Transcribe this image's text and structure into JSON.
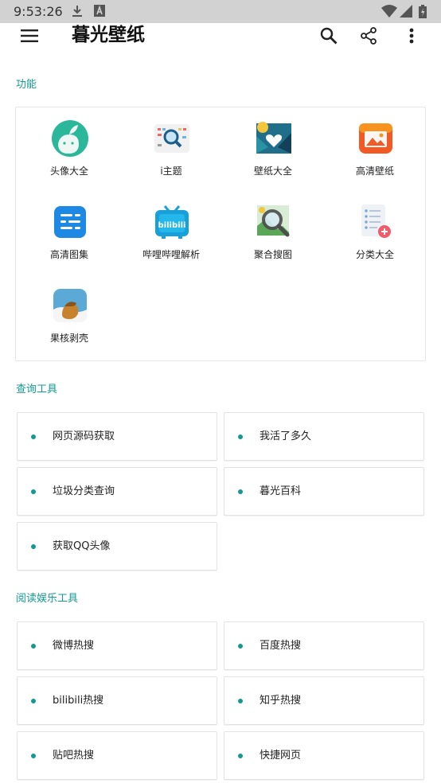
{
  "status_bar": {
    "time": "9:53:26"
  },
  "app_bar": {
    "title": "暮光壁纸",
    "menu_icon": "menu-icon",
    "search_icon": "search-icon",
    "share_icon": "share-icon",
    "more_icon": "more-vert-icon"
  },
  "colors": {
    "accent": "#129a90",
    "status_bar": "#d2d2d2"
  },
  "functions": {
    "title": "功能",
    "items": [
      {
        "label": "头像大全",
        "icon": "avatar-sprout-icon"
      },
      {
        "label": "i主题",
        "icon": "theme-search-icon"
      },
      {
        "label": "壁纸大全",
        "icon": "wallpaper-heart-icon"
      },
      {
        "label": "高清壁纸",
        "icon": "hd-wallpaper-icon"
      },
      {
        "label": "高清图集",
        "icon": "gallery-list-icon"
      },
      {
        "label": "哔哩哔哩解析",
        "icon": "bilibili-tv-icon"
      },
      {
        "label": "聚合搜图",
        "icon": "image-search-icon"
      },
      {
        "label": "分类大全",
        "icon": "category-list-icon"
      },
      {
        "label": "果核剥壳",
        "icon": "nut-icon"
      }
    ]
  },
  "query_tools": {
    "title": "查询工具",
    "items": [
      "网页源码获取",
      "我活了多久",
      "垃圾分类查询",
      "暮光百科",
      "获取QQ头像"
    ]
  },
  "reading_tools": {
    "title": "阅读娱乐工具",
    "items": [
      "微博热搜",
      "百度热搜",
      "bilibili热搜",
      "知乎热搜",
      "贴吧热搜",
      "快捷网页"
    ]
  }
}
